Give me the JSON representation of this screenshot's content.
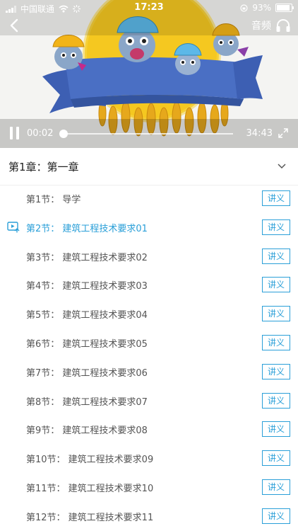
{
  "status_bar": {
    "carrier": "中国联通",
    "time": "17:23",
    "battery": "93%"
  },
  "player": {
    "audio_label": "音频",
    "current_time": "00:02",
    "total_time": "34:43",
    "progress_fraction": 0.001
  },
  "chapter": {
    "title": "第1章：第一章"
  },
  "lessons": [
    {
      "label": "第1节：  导学",
      "handout": "讲义",
      "active": false
    },
    {
      "label": "第2节：  建筑工程技术要求01",
      "handout": "讲义",
      "active": true
    },
    {
      "label": "第3节：  建筑工程技术要求02",
      "handout": "讲义",
      "active": false
    },
    {
      "label": "第4节：  建筑工程技术要求03",
      "handout": "讲义",
      "active": false
    },
    {
      "label": "第5节：  建筑工程技术要求04",
      "handout": "讲义",
      "active": false
    },
    {
      "label": "第6节：  建筑工程技术要求05",
      "handout": "讲义",
      "active": false
    },
    {
      "label": "第7节：  建筑工程技术要求06",
      "handout": "讲义",
      "active": false
    },
    {
      "label": "第8节：  建筑工程技术要求07",
      "handout": "讲义",
      "active": false
    },
    {
      "label": "第9节：  建筑工程技术要求08",
      "handout": "讲义",
      "active": false
    },
    {
      "label": "第10节：  建筑工程技术要求09",
      "handout": "讲义",
      "active": false
    },
    {
      "label": "第11节：  建筑工程技术要求10",
      "handout": "讲义",
      "active": false
    },
    {
      "label": "第12节：  建筑工程技术要求11",
      "handout": "讲义",
      "active": false
    }
  ],
  "colors": {
    "accent": "#2a9fd8",
    "video_sun": "#f5c820",
    "banner": "#4a6fc4"
  }
}
